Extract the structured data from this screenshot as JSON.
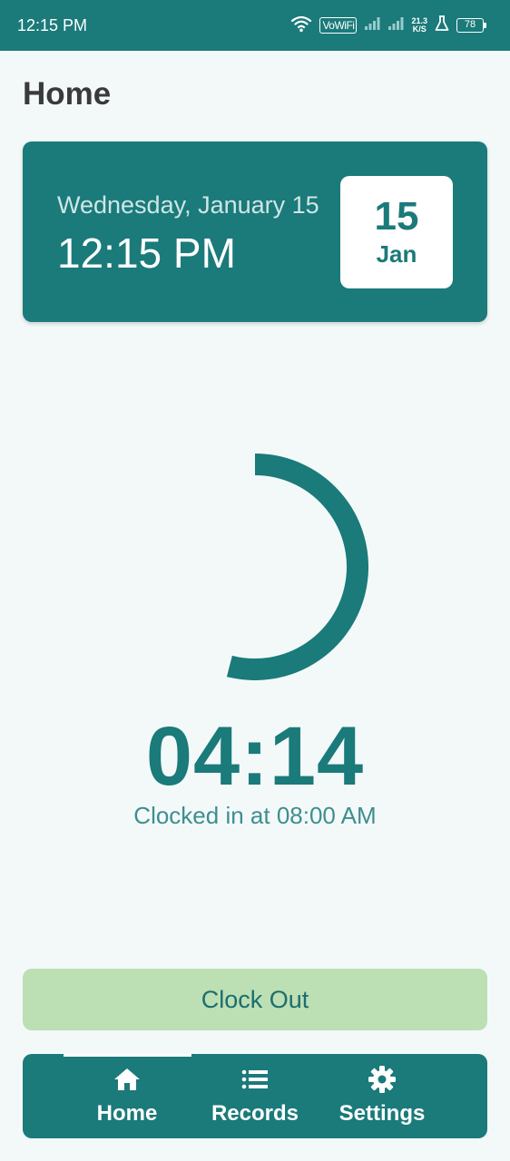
{
  "status_bar": {
    "time": "12:15 PM",
    "vowifi": "VoWiFi",
    "net_speed_value": "21.3",
    "net_speed_unit": "K/S",
    "battery": "78",
    "icons": [
      "wifi-icon",
      "signal-icon",
      "signal-icon",
      "lab-icon",
      "battery-icon"
    ]
  },
  "page": {
    "title": "Home"
  },
  "date_card": {
    "date_long": "Wednesday, January 15",
    "time": "12:15 PM",
    "badge_day": "15",
    "badge_month": "Jan"
  },
  "timer": {
    "elapsed": "04:14",
    "clocked_in_text": "Clocked in at 08:00 AM",
    "progress_fraction": 0.54
  },
  "actions": {
    "clock_out_label": "Clock Out"
  },
  "nav": {
    "items": [
      {
        "label": "Home",
        "icon": "home-icon",
        "active": true
      },
      {
        "label": "Records",
        "icon": "list-icon",
        "active": false
      },
      {
        "label": "Settings",
        "icon": "gear-icon",
        "active": false
      }
    ]
  },
  "colors": {
    "primary": "#1b7a7a",
    "background": "#f3f9f9",
    "clock_out_bg": "#bddfb4",
    "title_text": "#3a3a3a"
  }
}
